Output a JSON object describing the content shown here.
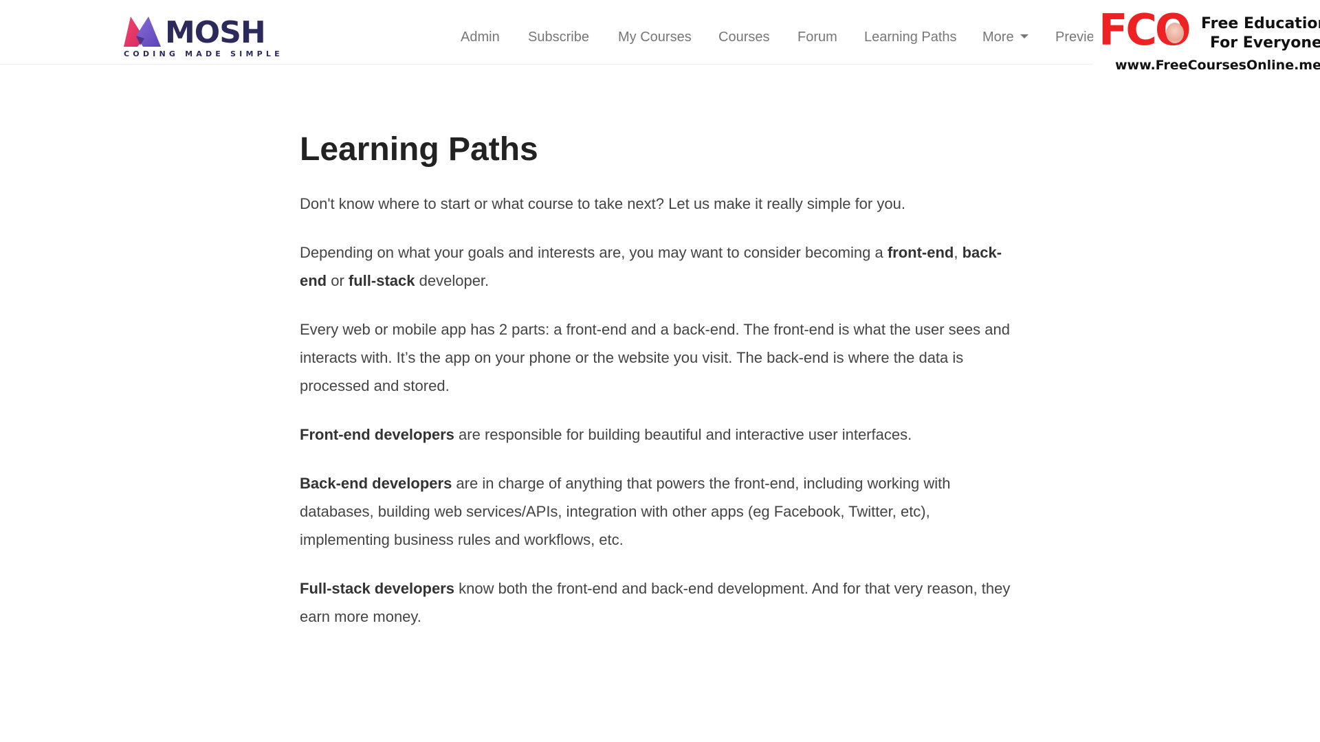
{
  "brand": {
    "name": "MOSH",
    "tagline": "CODING MADE SIMPLE"
  },
  "nav": {
    "items": [
      {
        "label": "Admin"
      },
      {
        "label": "Subscribe"
      },
      {
        "label": "My Courses"
      },
      {
        "label": "Courses"
      },
      {
        "label": "Forum"
      },
      {
        "label": "Learning Paths"
      },
      {
        "label": "More"
      },
      {
        "label": "Previews"
      }
    ],
    "more_caret_icon": "caret-down-icon"
  },
  "watermark": {
    "logo_text": "FCO",
    "line1": "Free Education",
    "line2": "For Everyone",
    "url": "www.FreeCoursesOnline.me"
  },
  "page": {
    "title": "Learning Paths",
    "p1": "Don't know where to start or what course to take next? Let us make it really simple for you.",
    "p2": {
      "t1": "Depending on what your goals and interests are, you may want to consider becoming a ",
      "b1": "front-end",
      "t2": ", ",
      "b2": "back-end",
      "t3": " or ",
      "b3": "full-stack",
      "t4": " developer."
    },
    "p3": "Every web or mobile app has 2 parts: a front-end and a back-end. The front-end is what the user sees and interacts with. It’s the app on your phone or the website you visit. The back-end is where the data is processed and stored.",
    "p4": {
      "b": "Front-end developers",
      "t": " are responsible for building beautiful and interactive user interfaces."
    },
    "p5": {
      "b": "Back-end developers",
      "t": " are in charge of anything that powers the front-end, including working with databases, building web services/APIs, integration with other apps (eg Facebook, Twitter, etc), implementing business rules and workflows, etc."
    },
    "p6": {
      "b": "Full-stack developers",
      "t": " know both the front-end and back-end development. And for that very reason, they earn more money."
    }
  },
  "colors": {
    "brand_navy": "#2b2a5a",
    "brand_pink": "#e8336d",
    "brand_purple": "#6a4fc7",
    "watermark_red": "#ee2222",
    "text": "#444444",
    "heading": "#222222",
    "nav_text": "#777777"
  }
}
